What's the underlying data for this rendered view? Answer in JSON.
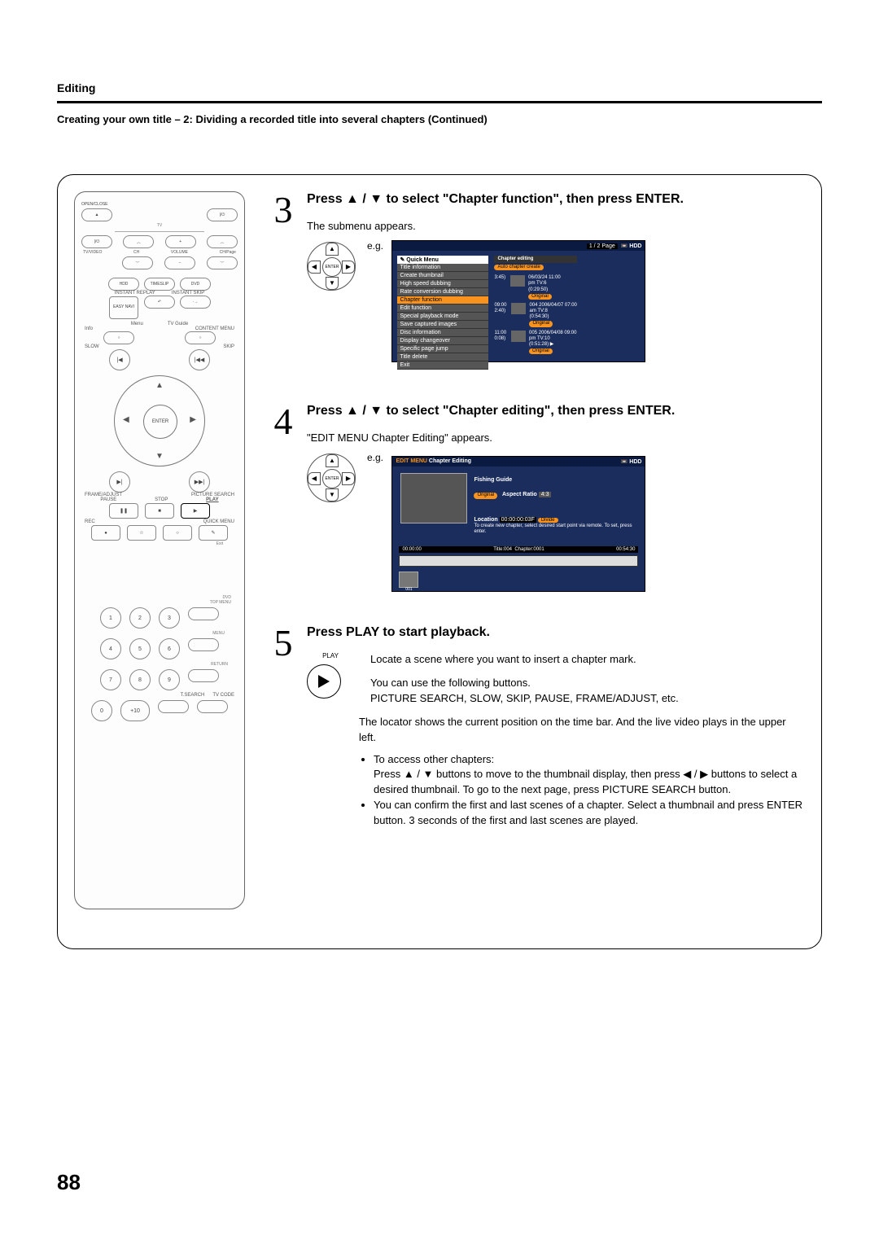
{
  "header": {
    "section": "Editing",
    "subtitle": "Creating your own title – 2: Dividing a recorded title into several chapters (Continued)"
  },
  "remote": {
    "open_close": "OPEN/CLOSE",
    "tv": "TV",
    "tv_video": "TV/VIDEO",
    "ch": "CH",
    "volume": "VOLUME",
    "ch_page": "CH/Page",
    "hdd": "HDD",
    "timeslip": "TIMESLIP",
    "dvd": "DVD",
    "instant_replay": "INSTANT REPLAY",
    "instant_skip": "INSTANT SKIP",
    "easy_navi": "EASY\nNAVI",
    "menu": "Menu",
    "tv_guide": "TV Guide",
    "info": "Info",
    "content_menu": "CONTENT MENU",
    "slow": "SLOW",
    "skip": "SKIP",
    "enter": "ENTER",
    "frame_adjust": "FRAME/ADJUST",
    "picture_search": "PICTURE SEARCH",
    "pause": "PAUSE",
    "stop": "STOP",
    "play": "PLAY",
    "rec": "REC",
    "quick_menu": "QUICK MENU",
    "exit": "Exit",
    "dvd_top_menu": "DVD\nTOP MENU",
    "menu2": "MENU",
    "return": "RETURN",
    "tsearch": "T.SEARCH",
    "tvcode": "TV CODE",
    "num": [
      "1",
      "2",
      "3",
      "4",
      "5",
      "6",
      "7",
      "8",
      "9",
      "0",
      "+10"
    ]
  },
  "step3": {
    "heading": "Press ▲ / ▼ to select \"Chapter function\", then press ENTER.",
    "sub": "The submenu appears.",
    "eg": "e.g.",
    "enter": "ENTER",
    "screen": {
      "page": "1 / 2  Page",
      "hdd": "HDD",
      "menu": [
        "Quick Menu",
        "Title information",
        "Create thumbnail",
        "High speed dubbing",
        "Rate conversion dubbing",
        "Chapter function",
        "Edit function",
        "Special playback mode",
        "Save captured images",
        "Disc information",
        "Display changeover",
        "Specific page jump",
        "Title delete",
        "Exit"
      ],
      "highlight": "Chapter function",
      "sub_hdr": "Chapter editing",
      "sub_item": "Auto chapter create",
      "list": [
        {
          "date": "06/03/24 11:00",
          "tv": "pm  TV:6",
          "dur": "(0:29:50)",
          "t1": "3:45)",
          "orig": "Original"
        },
        {
          "date": "2006/04/07 07:00",
          "tv": "am  TV:8",
          "dur": "(0:54:30)",
          "t1": "09:00",
          "t2": "2:40)",
          "orig": "Original"
        },
        {
          "date": "2006/04/08 09:00",
          "tv": "pm  TV:10",
          "dur": "(0:51:28)",
          "t1": "11:00",
          "t2": "0:08)",
          "orig": "Original"
        }
      ],
      "thumb_ids": [
        "004",
        "005"
      ]
    }
  },
  "step4": {
    "heading": "Press ▲ / ▼ to select \"Chapter editing\", then press ENTER.",
    "sub": "\"EDIT MENU Chapter Editing\" appears.",
    "eg": "e.g.",
    "enter": "ENTER",
    "screen": {
      "title": "EDIT MENU",
      "sub": "Chapter Editing",
      "hdd": "HDD",
      "name": "Fishing Guide",
      "orig": "Original",
      "aspect_lbl": "Aspect Ratio",
      "aspect": "4:3",
      "location_lbl": "Location",
      "location": "00:00:00:03F",
      "divide": "Divide",
      "hint": "To create new chapter, select desired start point via remote. To set, press enter.",
      "time_l": "00:00:00",
      "title_id": "Title:004",
      "chapter_id": "Chapter:0001",
      "time_r": "00:54:30",
      "footnum": "001"
    }
  },
  "step5": {
    "heading": "Press PLAY to start playback.",
    "play": "PLAY",
    "p1": "Locate a scene where you want to insert a chapter mark.",
    "p2": "You can use the following buttons.",
    "p3": "PICTURE SEARCH, SLOW, SKIP, PAUSE, FRAME/ADJUST, etc.",
    "p4": "The locator shows the current position on the time bar. And the live video plays in the upper left.",
    "bullets": [
      "To access other chapters:\nPress ▲ / ▼ buttons to move to the thumbnail display, then press ◀ / ▶ buttons to select a desired thumbnail. To go to the next page, press PICTURE SEARCH button.",
      "You can confirm the first and last scenes of a chapter. Select a thumbnail and press ENTER button. 3 seconds of the first and last scenes are played."
    ]
  },
  "page_number": "88"
}
